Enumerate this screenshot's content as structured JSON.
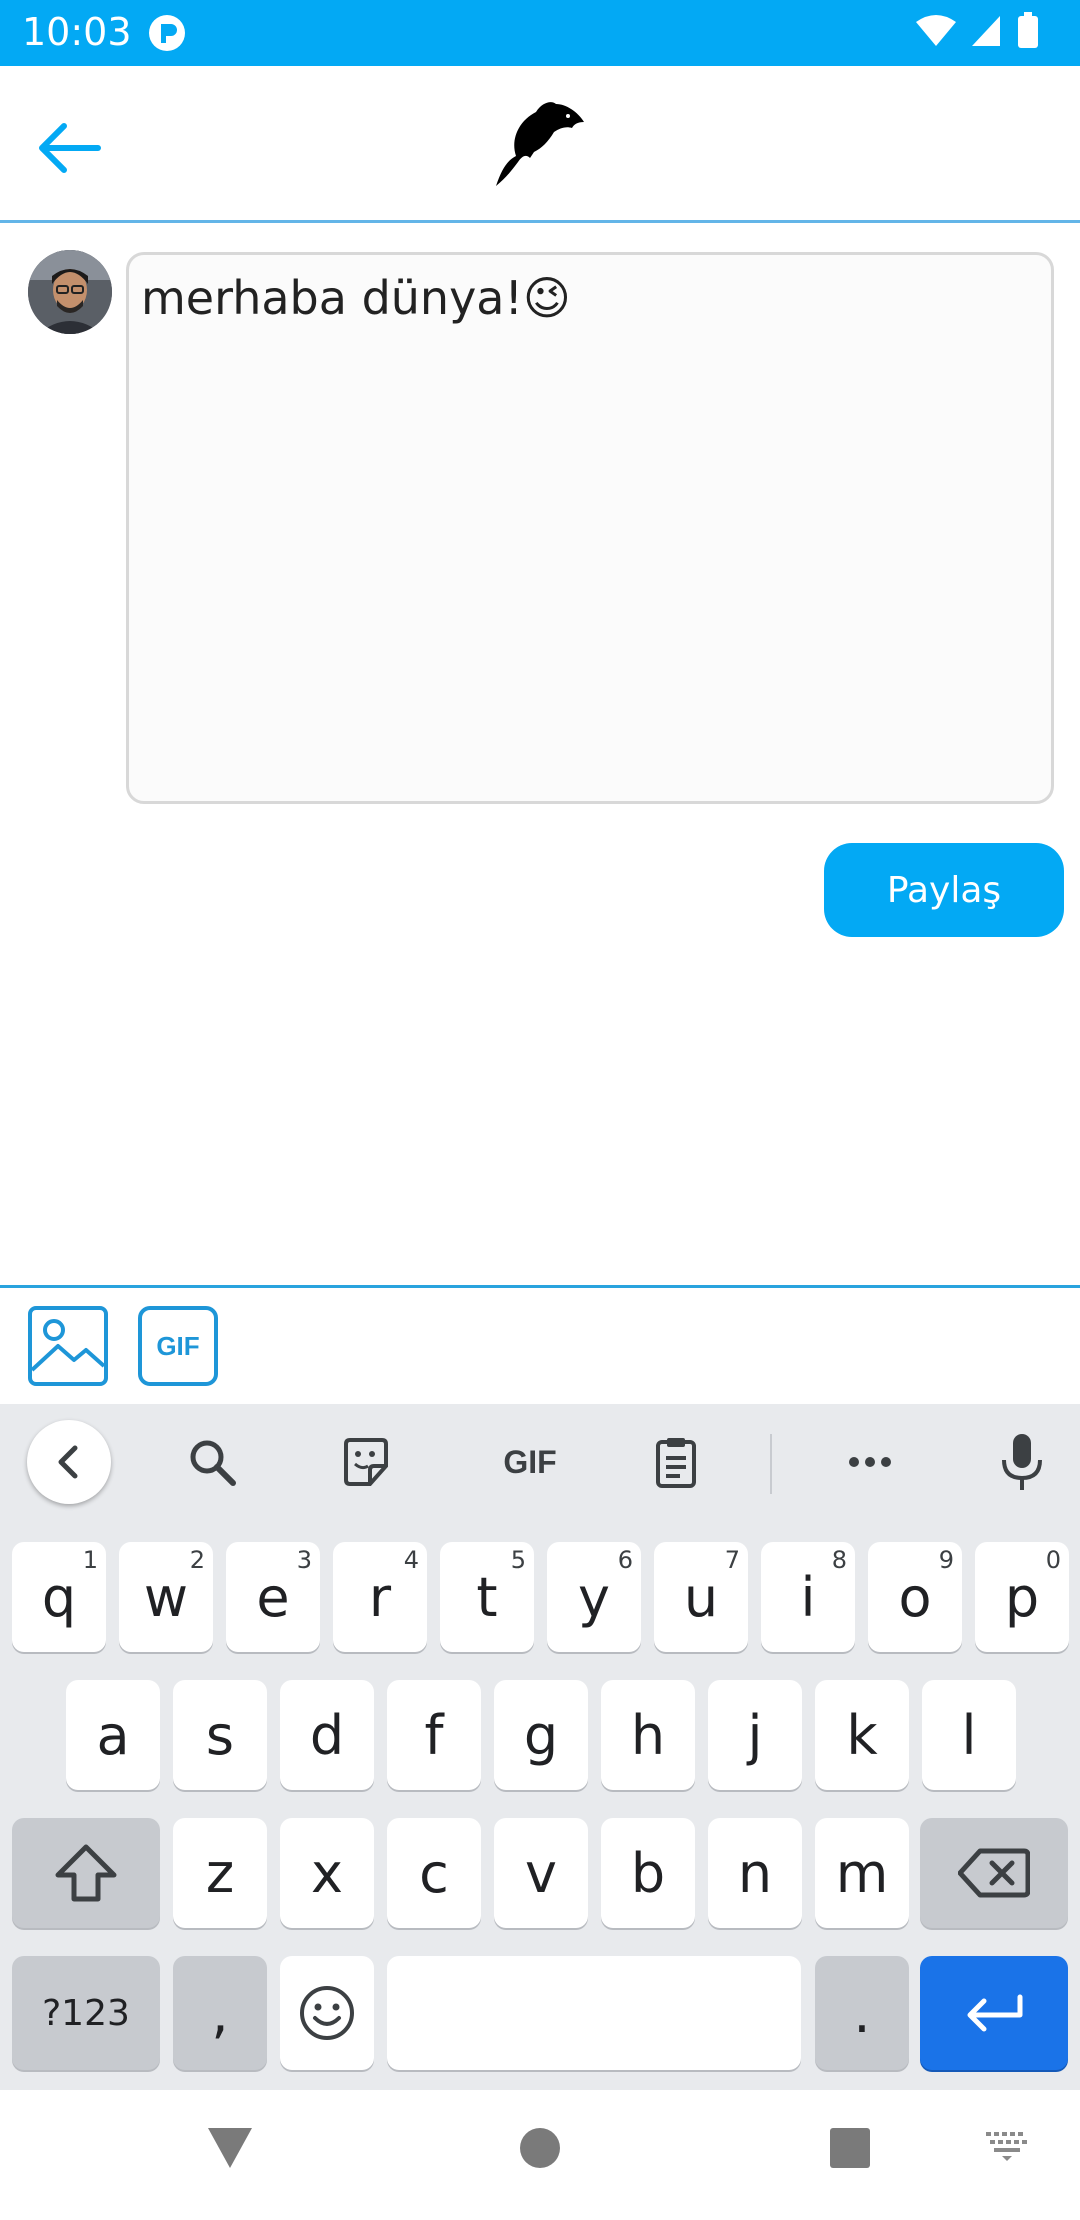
{
  "status_bar": {
    "time": "10:03"
  },
  "composer": {
    "text": "merhaba dünya!😉"
  },
  "share_button": {
    "label": "Paylaş"
  },
  "media_bar": {
    "gif_label": "GIF"
  },
  "keyboard": {
    "suggestion_gif_label": "GIF",
    "row1": [
      {
        "k": "q",
        "s": "1"
      },
      {
        "k": "w",
        "s": "2"
      },
      {
        "k": "e",
        "s": "3"
      },
      {
        "k": "r",
        "s": "4"
      },
      {
        "k": "t",
        "s": "5"
      },
      {
        "k": "y",
        "s": "6"
      },
      {
        "k": "u",
        "s": "7"
      },
      {
        "k": "i",
        "s": "8"
      },
      {
        "k": "o",
        "s": "9"
      },
      {
        "k": "p",
        "s": "0"
      }
    ],
    "row2": [
      "a",
      "s",
      "d",
      "f",
      "g",
      "h",
      "j",
      "k",
      "l"
    ],
    "row3": [
      "z",
      "x",
      "c",
      "v",
      "b",
      "n",
      "m"
    ],
    "symbols_label": "?123",
    "comma": ",",
    "period": "."
  },
  "colors": {
    "accent": "#03A9F4",
    "enter": "#1a73e8",
    "keyboard_bg": "#e8eaed"
  }
}
